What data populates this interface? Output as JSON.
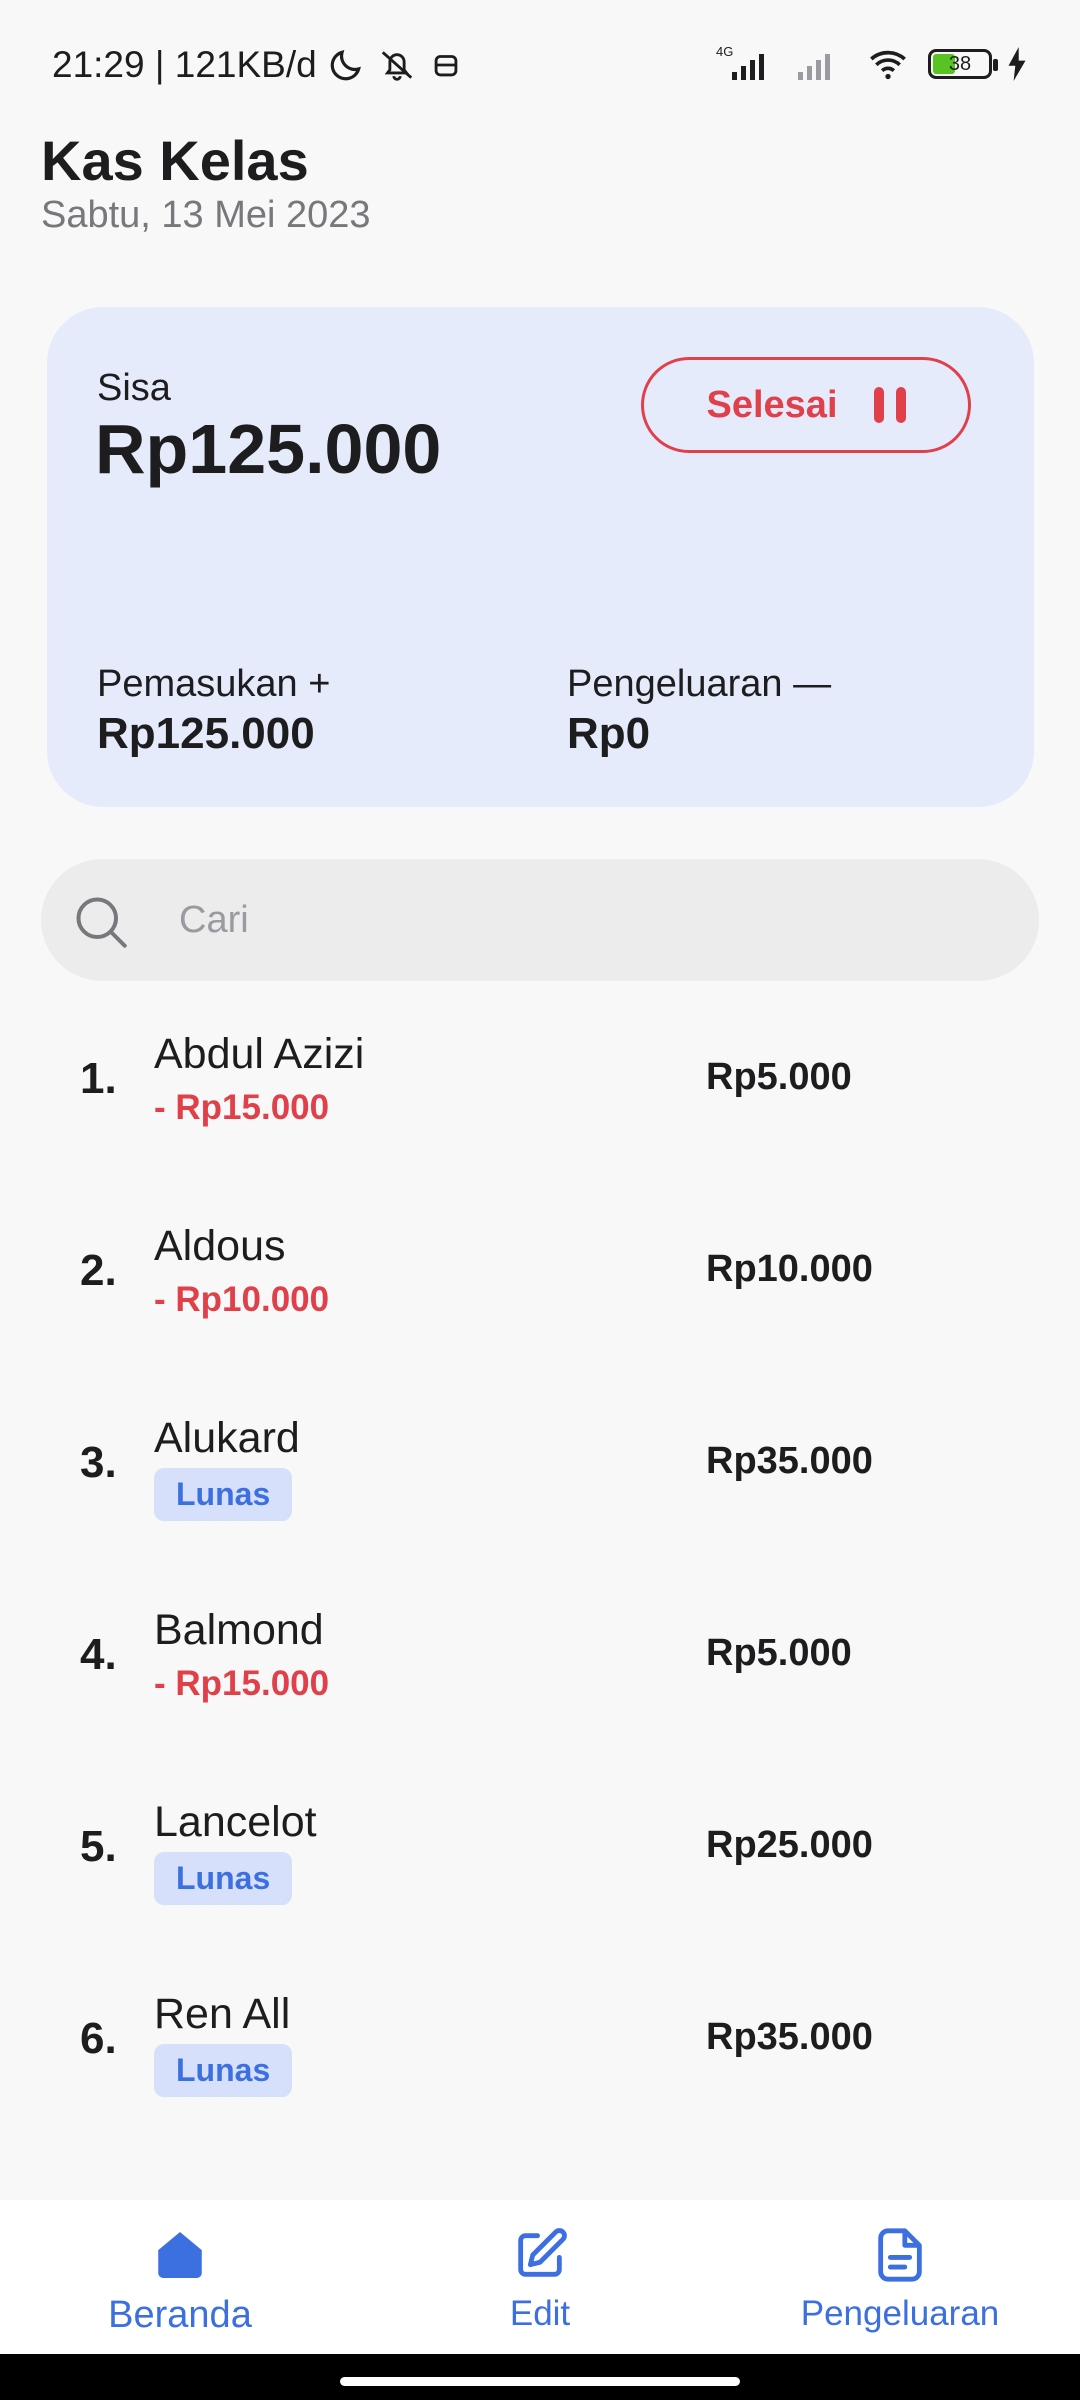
{
  "status_bar": {
    "time": "21:29 | 121KB/d",
    "network": "4G",
    "battery": "38"
  },
  "header": {
    "title": "Kas Kelas",
    "date": "Sabtu, 13 Mei 2023"
  },
  "summary": {
    "balance_label": "Sisa",
    "balance_value": "Rp125.000",
    "finish_button": "Selesai",
    "income_label": "Pemasukan +",
    "income_value": "Rp125.000",
    "expense_label": "Pengeluaran —",
    "expense_value": "Rp0"
  },
  "search": {
    "placeholder": "Cari"
  },
  "members": [
    {
      "number": "1.",
      "name": "Abdul Azizi",
      "due": "- Rp15.000",
      "paid": "Rp5.000"
    },
    {
      "number": "2.",
      "name": "Aldous",
      "due": "- Rp10.000",
      "paid": "Rp10.000"
    },
    {
      "number": "3.",
      "name": "Alukard",
      "badge": "Lunas",
      "paid": "Rp35.000"
    },
    {
      "number": "4.",
      "name": "Balmond",
      "due": "- Rp15.000",
      "paid": "Rp5.000"
    },
    {
      "number": "5.",
      "name": "Lancelot",
      "badge": "Lunas",
      "paid": "Rp25.000"
    },
    {
      "number": "6.",
      "name": "Ren All",
      "badge": "Lunas",
      "paid": "Rp35.000"
    }
  ],
  "nav": {
    "home": "Beranda",
    "edit": "Edit",
    "expenses": "Pengeluaran"
  },
  "colors": {
    "accent": "#3c6fe0",
    "danger": "#e0404a",
    "card": "#e6ebfb"
  }
}
